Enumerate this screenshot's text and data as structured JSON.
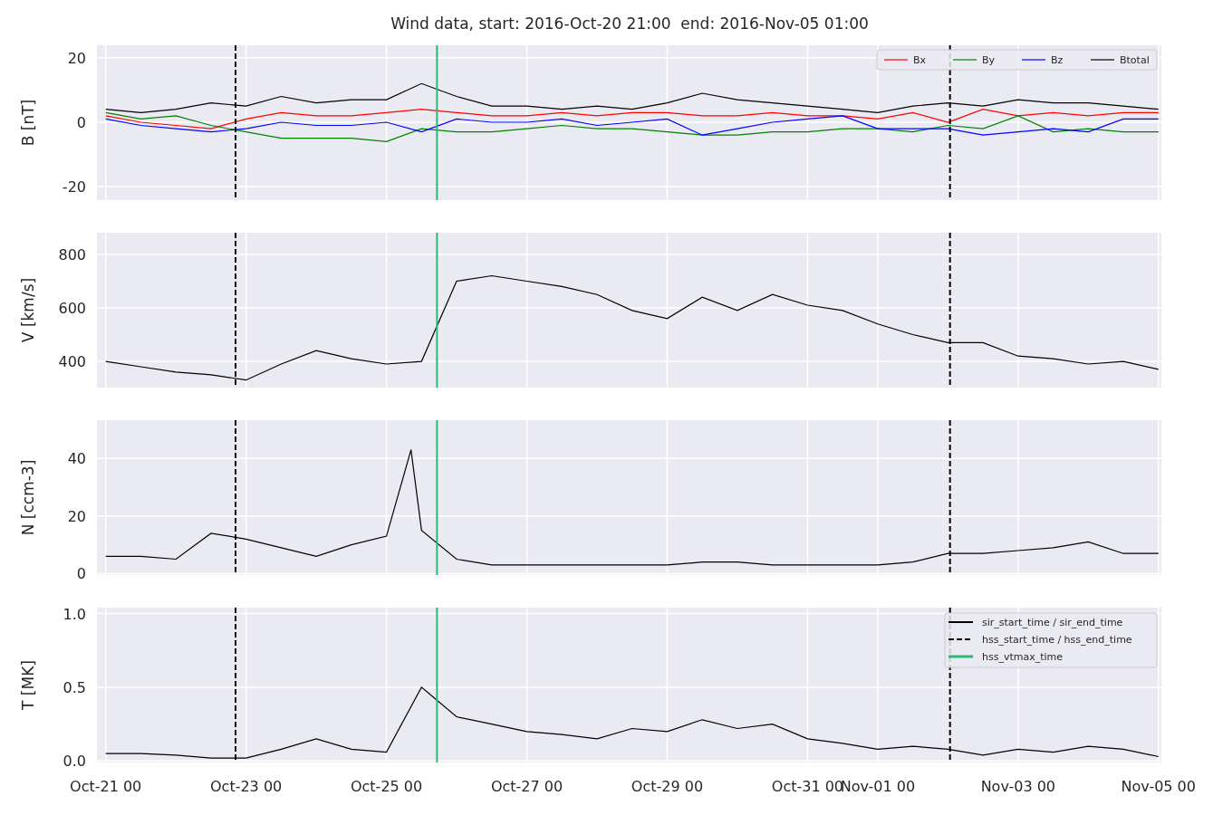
{
  "title": "Wind data, start: 2016-Oct-20 21:00  end: 2016-Nov-05 01:00",
  "panels": [
    {
      "chart_data": {
        "type": "line",
        "ylabel": "B [nT]",
        "x": [
          "2016-10-21T00:00",
          "2016-10-21T12:00",
          "2016-10-22T00:00",
          "2016-10-22T12:00",
          "2016-10-23T00:00",
          "2016-10-23T12:00",
          "2016-10-24T00:00",
          "2016-10-24T12:00",
          "2016-10-25T00:00",
          "2016-10-25T12:00",
          "2016-10-26T00:00",
          "2016-10-26T12:00",
          "2016-10-27T00:00",
          "2016-10-27T12:00",
          "2016-10-28T00:00",
          "2016-10-28T12:00",
          "2016-10-29T00:00",
          "2016-10-29T12:00",
          "2016-10-30T00:00",
          "2016-10-30T12:00",
          "2016-10-31T00:00",
          "2016-10-31T12:00",
          "2016-11-01T00:00",
          "2016-11-01T12:00",
          "2016-11-02T00:00",
          "2016-11-02T12:00",
          "2016-11-03T00:00",
          "2016-11-03T12:00",
          "2016-11-04T00:00",
          "2016-11-04T12:00",
          "2016-11-05T00:00"
        ],
        "xlim": [
          "2016-10-20T21:00",
          "2016-11-05T01:00"
        ],
        "ylim": [
          -24.2,
          23.9
        ],
        "yticks": [
          -20,
          0,
          20
        ],
        "grid": true,
        "legend": "upper right",
        "ref_lines": [
          {
            "axis": "x",
            "value": "2016-10-22T20:24",
            "color": "#000000"
          },
          {
            "axis": "x",
            "value": "2016-11-02T00:43",
            "color": "#000000"
          },
          {
            "axis": "x",
            "value": "2016-10-25T17:17",
            "color": "#2eb872"
          }
        ],
        "series": [
          {
            "name": "Bx",
            "color": "#ff0000",
            "values": [
              2,
              0,
              -1,
              -2,
              1,
              3,
              2,
              2,
              3,
              4,
              3,
              2,
              2,
              3,
              2,
              3,
              3,
              2,
              2,
              3,
              2,
              2,
              1,
              3,
              0,
              4,
              2,
              3,
              2,
              3,
              3
            ]
          },
          {
            "name": "By",
            "color": "#008000",
            "values": [
              3,
              1,
              2,
              -1,
              -3,
              -5,
              -5,
              -5,
              -6,
              -2,
              -3,
              -3,
              -2,
              -1,
              -2,
              -2,
              -3,
              -4,
              -4,
              -3,
              -3,
              -2,
              -2,
              -3,
              -1,
              -2,
              2,
              -3,
              -2,
              -3,
              -3
            ]
          },
          {
            "name": "Bz",
            "color": "#0000ff",
            "values": [
              1,
              -1,
              -2,
              -3,
              -2,
              0,
              -1,
              -1,
              0,
              -3,
              1,
              0,
              0,
              1,
              -1,
              0,
              1,
              -4,
              -2,
              0,
              1,
              2,
              -2,
              -2,
              -2,
              -4,
              -3,
              -2,
              -3,
              1,
              1
            ]
          },
          {
            "name": "Btotal",
            "color": "#000000",
            "values": [
              4,
              3,
              4,
              6,
              5,
              8,
              6,
              7,
              7,
              12,
              8,
              5,
              5,
              4,
              5,
              4,
              6,
              9,
              7,
              6,
              5,
              4,
              3,
              5,
              6,
              5,
              7,
              6,
              6,
              5,
              4
            ]
          }
        ]
      }
    },
    {
      "chart_data": {
        "type": "line",
        "ylabel": "V [km/s]",
        "x": [
          "2016-10-21T00:00",
          "2016-10-21T12:00",
          "2016-10-22T00:00",
          "2016-10-22T12:00",
          "2016-10-23T00:00",
          "2016-10-23T12:00",
          "2016-10-24T00:00",
          "2016-10-24T12:00",
          "2016-10-25T00:00",
          "2016-10-25T12:00",
          "2016-10-26T00:00",
          "2016-10-26T12:00",
          "2016-10-27T00:00",
          "2016-10-27T12:00",
          "2016-10-28T00:00",
          "2016-10-28T12:00",
          "2016-10-29T00:00",
          "2016-10-29T12:00",
          "2016-10-30T00:00",
          "2016-10-30T12:00",
          "2016-10-31T00:00",
          "2016-10-31T12:00",
          "2016-11-01T00:00",
          "2016-11-01T12:00",
          "2016-11-02T00:00",
          "2016-11-02T12:00",
          "2016-11-03T00:00",
          "2016-11-03T12:00",
          "2016-11-04T00:00",
          "2016-11-04T12:00",
          "2016-11-05T00:00"
        ],
        "xlim": [
          "2016-10-20T21:00",
          "2016-11-05T01:00"
        ],
        "ylim": [
          302,
          881
        ],
        "yticks": [
          400,
          600,
          800
        ],
        "grid": true,
        "ref_lines": [
          {
            "axis": "x",
            "value": "2016-10-22T20:24",
            "color": "#000000"
          },
          {
            "axis": "x",
            "value": "2016-11-02T00:43",
            "color": "#000000"
          },
          {
            "axis": "x",
            "value": "2016-10-25T17:17",
            "color": "#2eb872"
          }
        ],
        "series": [
          {
            "color": "#000000",
            "values": [
              400,
              380,
              360,
              350,
              330,
              390,
              440,
              410,
              390,
              400,
              700,
              720,
              700,
              680,
              650,
              590,
              560,
              640,
              590,
              650,
              610,
              590,
              540,
              500,
              470,
              470,
              420,
              410,
              390,
              400,
              370
            ]
          }
        ]
      }
    },
    {
      "chart_data": {
        "type": "line",
        "ylabel": "N [ccm-3]",
        "x": [
          "2016-10-21T00:00",
          "2016-10-21T12:00",
          "2016-10-22T00:00",
          "2016-10-22T12:00",
          "2016-10-23T00:00",
          "2016-10-23T12:00",
          "2016-10-24T00:00",
          "2016-10-24T12:00",
          "2016-10-25T00:00",
          "2016-10-25T08:24",
          "2016-10-25T12:00",
          "2016-10-26T00:00",
          "2016-10-26T12:00",
          "2016-10-27T00:00",
          "2016-10-27T12:00",
          "2016-10-28T00:00",
          "2016-10-28T12:00",
          "2016-10-29T00:00",
          "2016-10-29T12:00",
          "2016-10-30T00:00",
          "2016-10-30T12:00",
          "2016-10-31T00:00",
          "2016-10-31T12:00",
          "2016-11-01T00:00",
          "2016-11-01T12:00",
          "2016-11-02T00:00",
          "2016-11-02T12:00",
          "2016-11-03T00:00",
          "2016-11-03T12:00",
          "2016-11-04T00:00",
          "2016-11-04T12:00",
          "2016-11-05T00:00"
        ],
        "xlim": [
          "2016-10-20T21:00",
          "2016-11-05T01:00"
        ],
        "ylim": [
          -0.5,
          53.3
        ],
        "yticks": [
          0,
          20,
          40
        ],
        "grid": true,
        "ref_lines": [
          {
            "axis": "x",
            "value": "2016-10-22T20:24",
            "color": "#000000"
          },
          {
            "axis": "x",
            "value": "2016-11-02T00:43",
            "color": "#000000"
          },
          {
            "axis": "x",
            "value": "2016-10-25T17:17",
            "color": "#2eb872"
          }
        ],
        "series": [
          {
            "color": "#000000",
            "values": [
              6,
              6,
              5,
              14,
              12,
              9,
              6,
              10,
              13,
              43,
              15,
              5,
              3,
              3,
              3,
              3,
              3,
              3,
              4,
              4,
              3,
              3,
              3,
              3,
              4,
              7,
              7,
              8,
              9,
              11,
              7,
              7
            ]
          }
        ]
      }
    },
    {
      "chart_data": {
        "type": "line",
        "ylabel": "T [MK]",
        "x": [
          "2016-10-21T00:00",
          "2016-10-21T12:00",
          "2016-10-22T00:00",
          "2016-10-22T12:00",
          "2016-10-23T00:00",
          "2016-10-23T12:00",
          "2016-10-24T00:00",
          "2016-10-24T12:00",
          "2016-10-25T00:00",
          "2016-10-25T12:00",
          "2016-10-26T00:00",
          "2016-10-26T12:00",
          "2016-10-27T00:00",
          "2016-10-27T12:00",
          "2016-10-28T00:00",
          "2016-10-28T12:00",
          "2016-10-29T00:00",
          "2016-10-29T12:00",
          "2016-10-30T00:00",
          "2016-10-30T12:00",
          "2016-10-31T00:00",
          "2016-10-31T12:00",
          "2016-11-01T00:00",
          "2016-11-01T12:00",
          "2016-11-02T00:00",
          "2016-11-02T12:00",
          "2016-11-03T00:00",
          "2016-11-03T12:00",
          "2016-11-04T00:00",
          "2016-11-04T12:00",
          "2016-11-05T00:00"
        ],
        "xlim": [
          "2016-10-20T21:00",
          "2016-11-05T01:00"
        ],
        "ylim": [
          -0.01,
          1.04
        ],
        "grid": true,
        "ref_lines": [
          {
            "axis": "x",
            "value": "2016-10-22T20:24",
            "color": "#000000"
          },
          {
            "axis": "x",
            "value": "2016-11-02T00:43",
            "color": "#000000"
          },
          {
            "axis": "x",
            "value": "2016-10-25T17:17",
            "color": "#2eb872"
          }
        ],
        "yticks": [
          {
            "value": 0,
            "label": "0.0"
          },
          {
            "value": 0.5,
            "label": "0.5"
          },
          {
            "value": 1,
            "label": "1.0"
          }
        ],
        "xticks": [
          {
            "value": "2016-10-21T00:00",
            "label": "Oct-21 00"
          },
          {
            "value": "2016-10-23T00:00",
            "label": "Oct-23 00"
          },
          {
            "value": "2016-10-25T00:00",
            "label": "Oct-25 00"
          },
          {
            "value": "2016-10-27T00:00",
            "label": "Oct-27 00"
          },
          {
            "value": "2016-10-29T00:00",
            "label": "Oct-29 00"
          },
          {
            "value": "2016-10-31T00:00",
            "label": "Oct-31 00"
          },
          {
            "value": "2016-11-01T00:00",
            "label": "Nov-01 00"
          },
          {
            "value": "2016-11-03T00:00",
            "label": "Nov-03 00"
          },
          {
            "value": "2016-11-05T00:00",
            "label": "Nov-05 00"
          }
        ],
        "series": [
          {
            "color": "#000000",
            "values": [
              0.05,
              0.05,
              0.04,
              0.02,
              0.02,
              0.08,
              0.15,
              0.08,
              0.06,
              0.5,
              0.3,
              0.25,
              0.2,
              0.18,
              0.15,
              0.22,
              0.2,
              0.28,
              0.22,
              0.25,
              0.15,
              0.12,
              0.08,
              0.1,
              0.08,
              0.04,
              0.08,
              0.06,
              0.1,
              0.08,
              0.03
            ]
          }
        ]
      },
      "legend": [
        {
          "label": "sir_start_time / sir_end_time",
          "dashed": false,
          "color": "#000000"
        },
        {
          "label": "hss_start_time / hss_end_time",
          "dashed": true,
          "color": "#000000"
        },
        {
          "label": "hss_vtmax_time",
          "dashed": false,
          "color": "#2eb872"
        }
      ]
    }
  ]
}
